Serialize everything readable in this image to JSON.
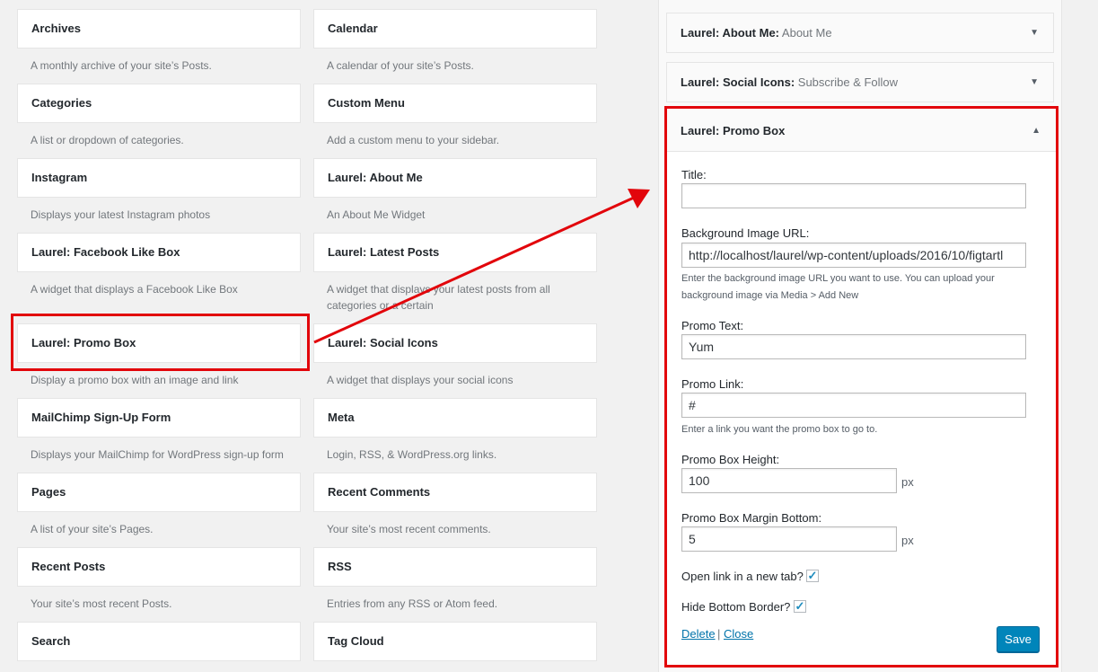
{
  "available_widgets": [
    {
      "name": "Archives",
      "desc": "A monthly archive of your site’s Posts."
    },
    {
      "name": "Calendar",
      "desc": "A calendar of your site’s Posts."
    },
    {
      "name": "Categories",
      "desc": "A list or dropdown of categories."
    },
    {
      "name": "Custom Menu",
      "desc": "Add a custom menu to your sidebar."
    },
    {
      "name": "Instagram",
      "desc": "Displays your latest Instagram photos"
    },
    {
      "name": "Laurel: About Me",
      "desc": "An About Me Widget"
    },
    {
      "name": "Laurel: Facebook Like Box",
      "desc": "A widget that displays a Facebook Like Box"
    },
    {
      "name": "Laurel: Latest Posts",
      "desc": "A widget that displays your latest posts from all categories or a certain"
    },
    {
      "name": "Laurel: Promo Box",
      "desc": "Display a promo box with an image and link"
    },
    {
      "name": "Laurel: Social Icons",
      "desc": "A widget that displays your social icons"
    },
    {
      "name": "MailChimp Sign-Up Form",
      "desc": "Displays your MailChimp for WordPress sign-up form"
    },
    {
      "name": "Meta",
      "desc": "Login, RSS, & WordPress.org links."
    },
    {
      "name": "Pages",
      "desc": "A list of your site’s Pages."
    },
    {
      "name": "Recent Comments",
      "desc": "Your site’s most recent comments."
    },
    {
      "name": "Recent Posts",
      "desc": "Your site’s most recent Posts."
    },
    {
      "name": "RSS",
      "desc": "Entries from any RSS or Atom feed."
    },
    {
      "name": "Search",
      "desc": ""
    },
    {
      "name": "Tag Cloud",
      "desc": ""
    }
  ],
  "sidebar_widgets": [
    {
      "name": "Laurel: About Me:",
      "subtitle": "About Me"
    },
    {
      "name": "Laurel: Social Icons:",
      "subtitle": "Subscribe & Follow"
    }
  ],
  "promo_widget": {
    "title": "Laurel: Promo Box",
    "fields": {
      "title_label": "Title:",
      "title_value": "",
      "bg_label": "Background Image URL:",
      "bg_value": "http://localhost/laurel/wp-content/uploads/2016/10/figtartl",
      "bg_help": "Enter the background image URL you want to use. You can upload your background image via Media > Add New",
      "text_label": "Promo Text:",
      "text_value": "Yum",
      "link_label": "Promo Link:",
      "link_value": "#",
      "link_help": "Enter a link you want the promo box to go to.",
      "height_label": "Promo Box Height:",
      "height_value": "100",
      "margin_label": "Promo Box Margin Bottom:",
      "margin_value": "5",
      "unit": "px",
      "new_tab_label": "Open link in a new tab?",
      "new_tab_checked": true,
      "hide_border_label": "Hide Bottom Border?",
      "hide_border_checked": true
    },
    "delete_label": "Delete",
    "separator": "|",
    "close_label": "Close",
    "save_label": "Save"
  },
  "colors": {
    "highlight": "#e2050b",
    "primary_button": "#0085ba",
    "link": "#0073aa"
  }
}
